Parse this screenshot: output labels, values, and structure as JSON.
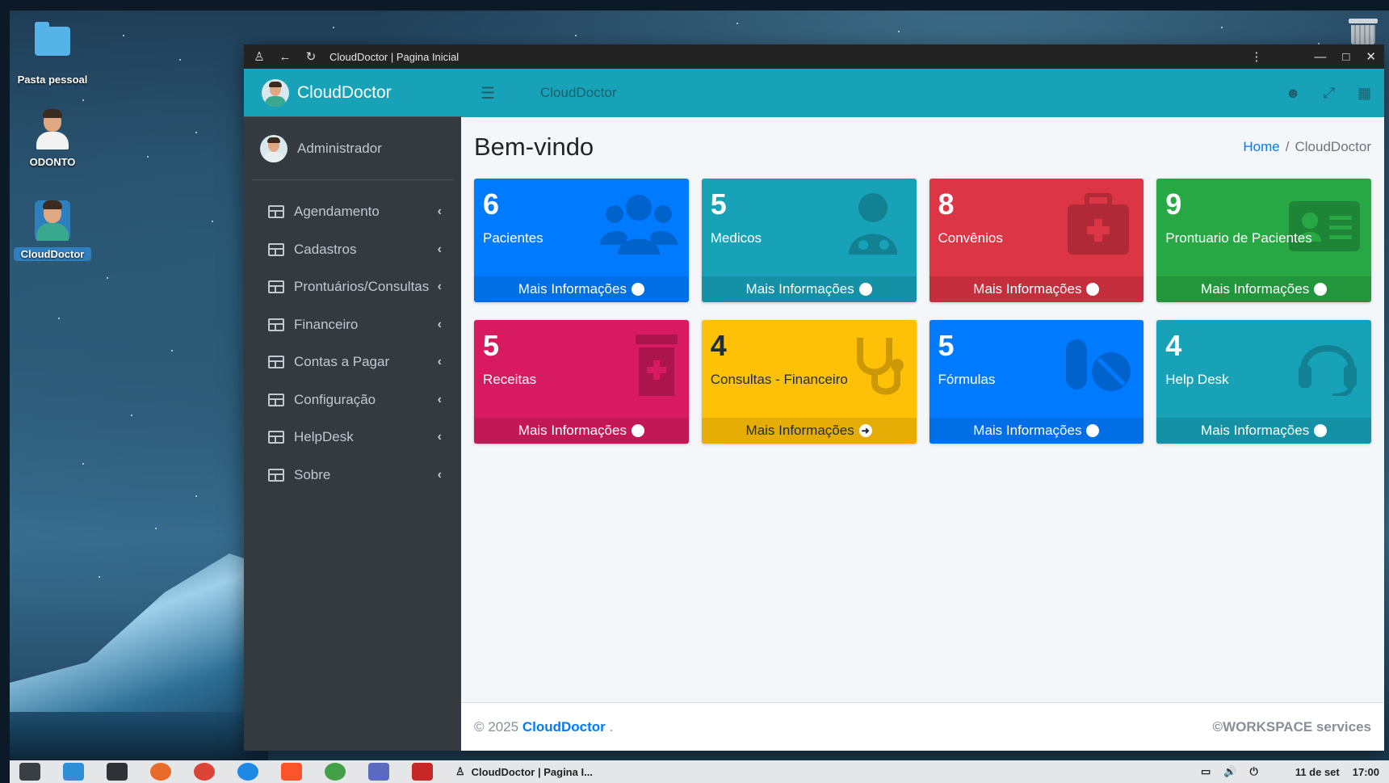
{
  "desktop": {
    "icons": [
      {
        "label": "Pasta pessoal"
      },
      {
        "label": "ODONTO"
      },
      {
        "label": "CloudDoctor"
      }
    ]
  },
  "browser": {
    "title": "CloudDoctor | Pagina Inicial"
  },
  "sidebar": {
    "brand": "CloudDoctor",
    "user": "Administrador",
    "items": [
      {
        "label": "Agendamento"
      },
      {
        "label": "Cadastros"
      },
      {
        "label": "Prontuários/Consultas"
      },
      {
        "label": "Financeiro"
      },
      {
        "label": "Contas a Pagar"
      },
      {
        "label": "Configuração"
      },
      {
        "label": "HelpDesk"
      },
      {
        "label": "Sobre"
      }
    ]
  },
  "topnav": {
    "title": "CloudDoctor"
  },
  "page": {
    "title": "Bem-vindo",
    "breadcrumb": {
      "home": "Home",
      "separator": "/",
      "current": "CloudDoctor"
    }
  },
  "cards": [
    {
      "count": "6",
      "label": "Pacientes",
      "more": "Mais Informações",
      "color": "#007bff",
      "icon": "users-icon"
    },
    {
      "count": "5",
      "label": "Medicos",
      "more": "Mais Informações",
      "color": "#17a2b8",
      "icon": "doctor-icon"
    },
    {
      "count": "8",
      "label": "Convênios",
      "more": "Mais Informações",
      "color": "#dc3545",
      "icon": "medkit-icon"
    },
    {
      "count": "9",
      "label": "Prontuario de Pacientes",
      "more": "Mais Informações",
      "color": "#28a745",
      "icon": "id-card-icon"
    },
    {
      "count": "5",
      "label": "Receitas",
      "more": "Mais Informações",
      "color": "#d81b60",
      "icon": "prescription-bottle-icon"
    },
    {
      "count": "4",
      "label": "Consultas - Financeiro",
      "more": "Mais Informações",
      "color": "#ffc107",
      "icon": "stethoscope-icon"
    },
    {
      "count": "5",
      "label": "Fórmulas",
      "more": "Mais Informações",
      "color": "#007bff",
      "icon": "pills-icon"
    },
    {
      "count": "4",
      "label": "Help Desk",
      "more": "Mais Informações",
      "color": "#17a2b8",
      "icon": "headset-icon"
    }
  ],
  "footer": {
    "copyright": "© 2025",
    "brand": "CloudDoctor",
    "dot": ".",
    "right": "©WORKSPACE services"
  },
  "taskbar": {
    "active_window": "CloudDoctor | Pagina I...",
    "date": "11 de set",
    "time": "17:00"
  }
}
